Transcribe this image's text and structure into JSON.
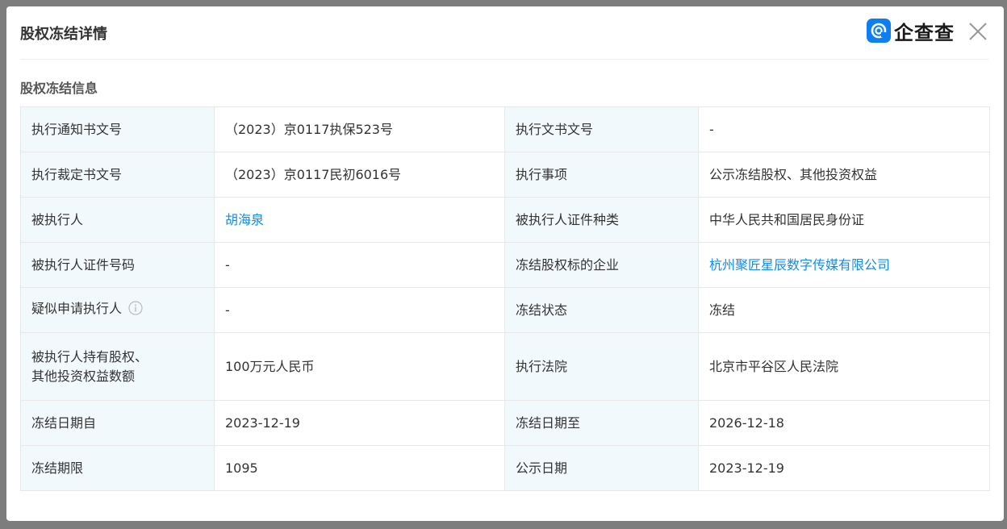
{
  "modal": {
    "title": "股权冻结详情",
    "brand": "企查查",
    "section_title": "股权冻结信息"
  },
  "rows": [
    {
      "l1": "执行通知书文号",
      "v1": "（2023）京0117执保523号",
      "l2": "执行文书文号",
      "v2": "-"
    },
    {
      "l1": "执行裁定书文号",
      "v1": "（2023）京0117民初6016号",
      "l2": "执行事项",
      "v2": "公示冻结股权、其他投资权益"
    },
    {
      "l1": "被执行人",
      "v1": "胡海泉",
      "l2": "被执行人证件种类",
      "v2": "中华人民共和国居民身份证"
    },
    {
      "l1": "被执行人证件号码",
      "v1": "-",
      "l2": "冻结股权标的企业",
      "v2": "杭州聚匠星辰数字传媒有限公司"
    },
    {
      "l1": "疑似申请执行人",
      "v1": "-",
      "l2": "冻结状态",
      "v2": "冻结"
    },
    {
      "l1a": "被执行人持有股权、",
      "l1b": "其他投资权益数额",
      "v1": "100万元人民币",
      "l2": "执行法院",
      "v2": "北京市平谷区人民法院"
    },
    {
      "l1": "冻结日期自",
      "v1": "2023-12-19",
      "l2": "冻结日期至",
      "v2": "2026-12-18"
    },
    {
      "l1": "冻结期限",
      "v1": "1095",
      "l2": "公示日期",
      "v2": "2023-12-19"
    }
  ],
  "colors": {
    "link": "#128bed",
    "label_bg": "#f2f9fc",
    "brand_blue": "#0f7ff0"
  }
}
